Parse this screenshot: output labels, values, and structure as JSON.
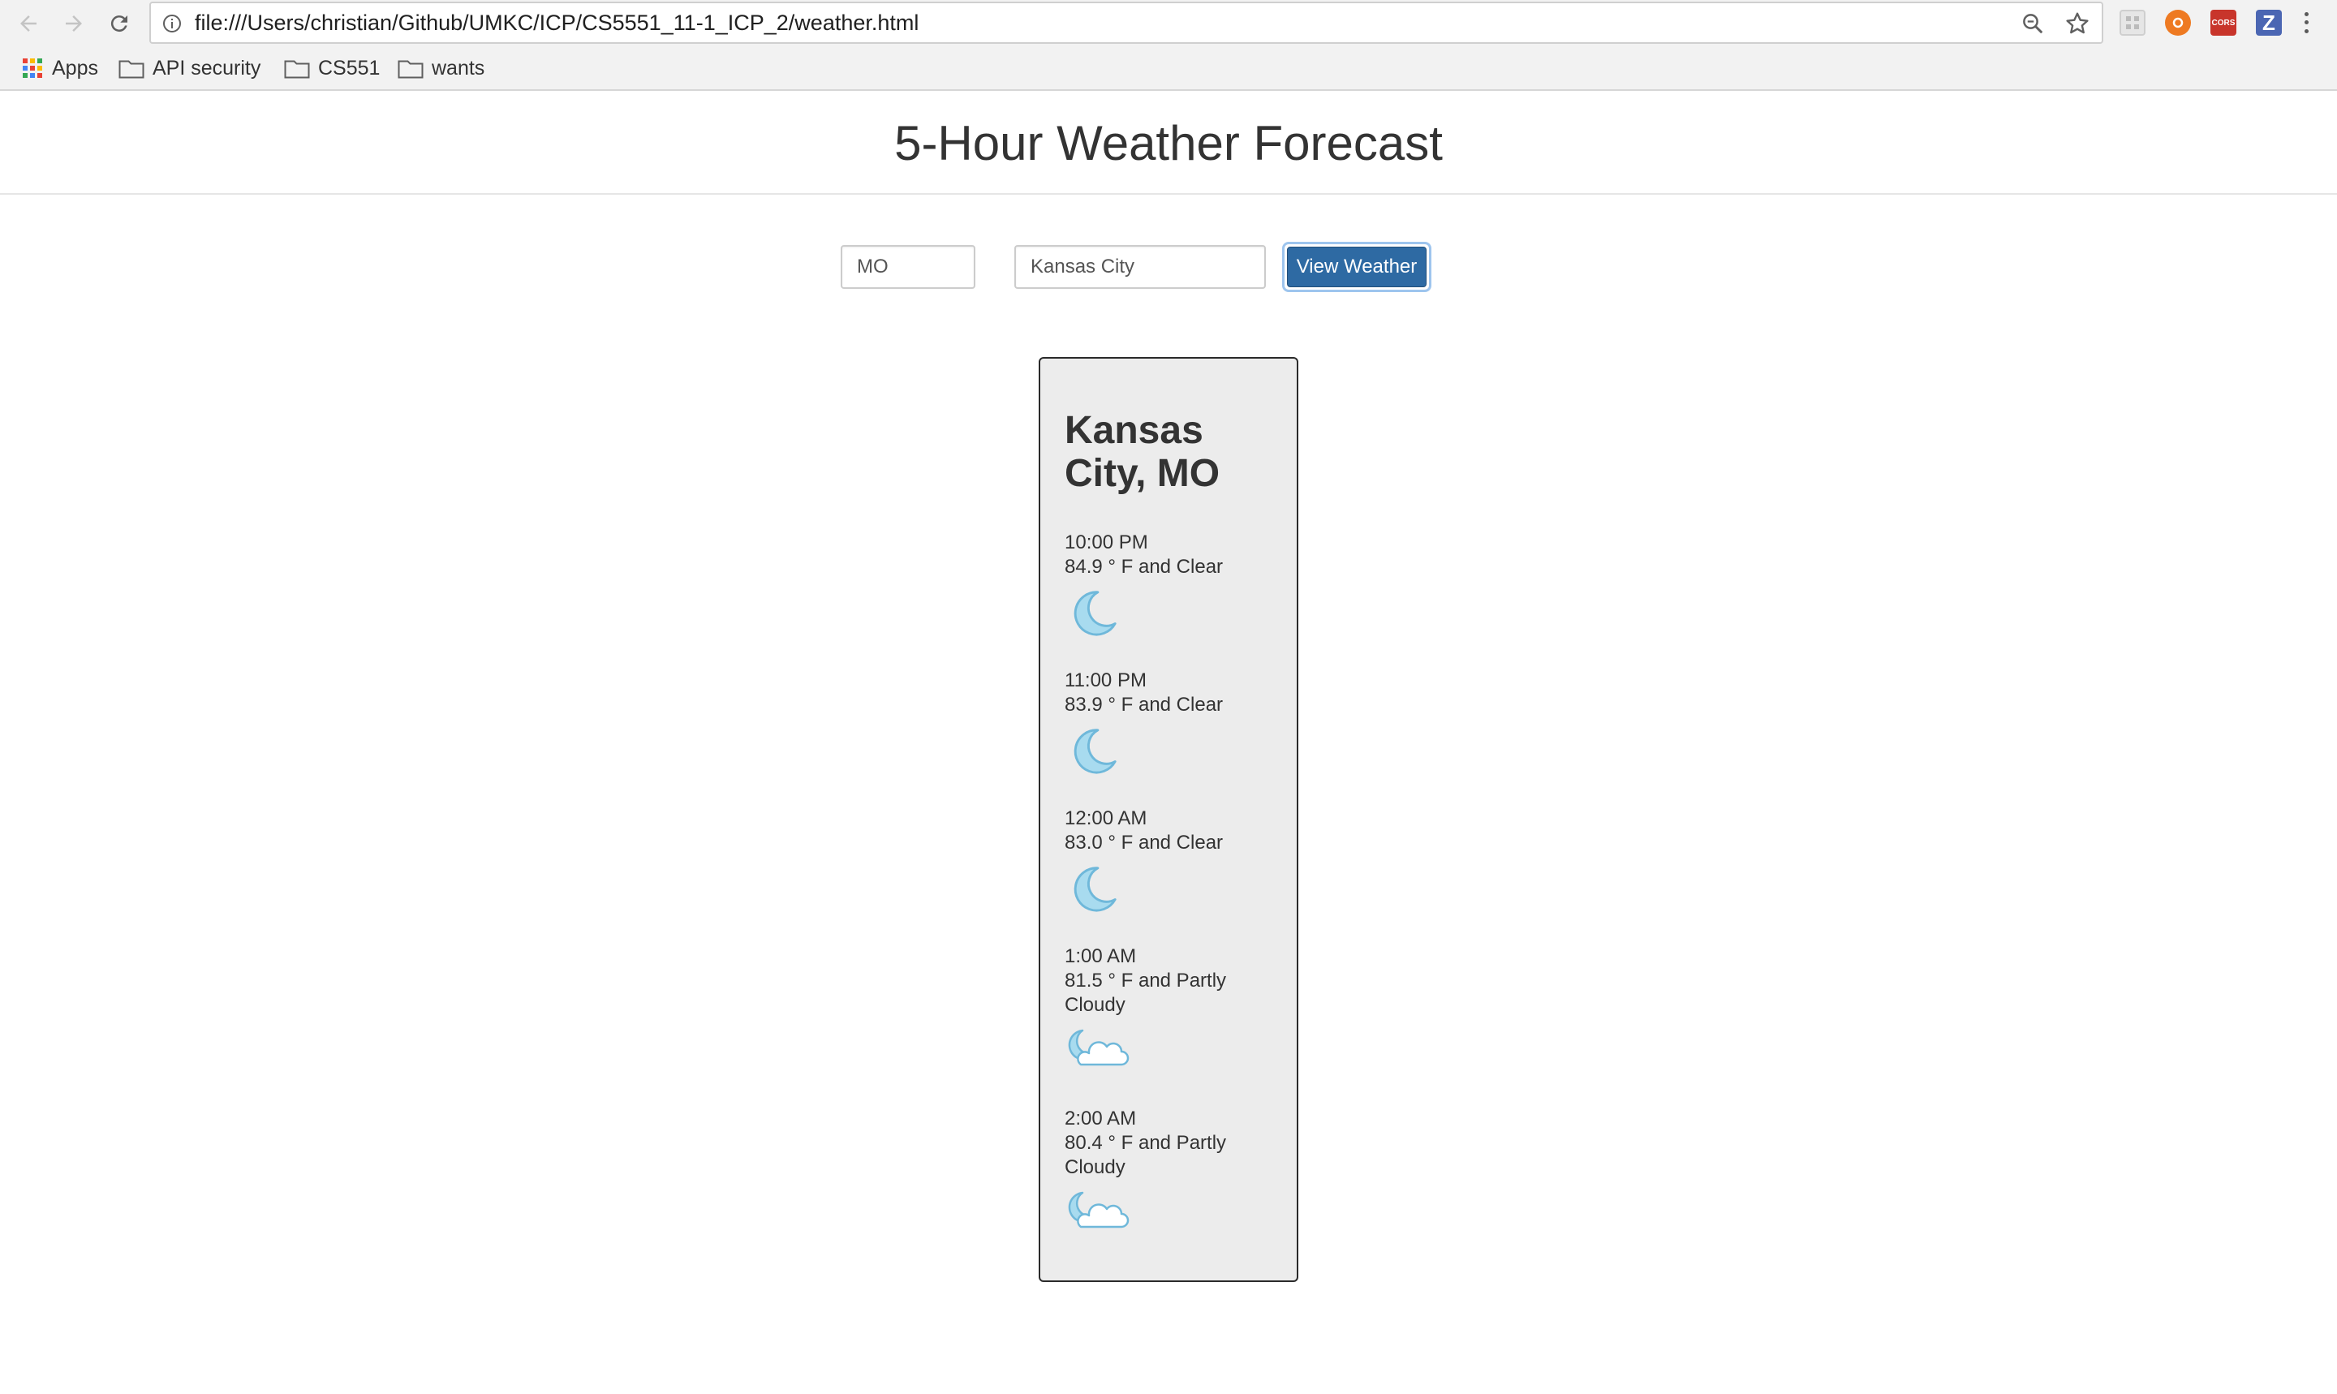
{
  "browser": {
    "url": "file:///Users/christian/Github/UMKC/ICP/CS5551_11-1_ICP_2/weather.html",
    "icons": {
      "back": "arrow-left-icon",
      "forward": "arrow-right-icon",
      "reload": "reload-icon",
      "info": "info-icon",
      "zoom": "magnifier-icon",
      "bookmark": "star-icon",
      "menu": "vertical-dots-icon"
    },
    "extensions": [
      {
        "name": "grid-extension-icon",
        "glyph": "",
        "color": "#d8d8d8"
      },
      {
        "name": "orange-extension-icon",
        "glyph": "",
        "color": "#ee7a22"
      },
      {
        "name": "cors-extension-icon",
        "glyph": "CORS",
        "color": "#c8352b"
      },
      {
        "name": "z-extension-icon",
        "glyph": "Z",
        "color": "#4b66b3"
      }
    ]
  },
  "bookmarks": [
    {
      "label": "Apps",
      "icon": "apps-grid-icon"
    },
    {
      "label": "API security",
      "icon": "folder-icon"
    },
    {
      "label": "CS551",
      "icon": "folder-icon"
    },
    {
      "label": "wants",
      "icon": "folder-icon"
    }
  ],
  "page": {
    "title": "5-Hour Weather Forecast"
  },
  "form": {
    "state_value": "MO",
    "city_value": "Kansas City",
    "submit_label": "View Weather",
    "submit_color": "#2e6aa3"
  },
  "forecast": {
    "location": "Kansas City, MO",
    "hours": [
      {
        "time": "10:00 PM",
        "desc": "84.9 ° F and Clear",
        "icon": "moon-icon"
      },
      {
        "time": "11:00 PM",
        "desc": "83.9 ° F and Clear",
        "icon": "moon-icon"
      },
      {
        "time": "12:00 AM",
        "desc": "83.0 ° F and Clear",
        "icon": "moon-icon"
      },
      {
        "time": "1:00 AM",
        "desc": "81.5 ° F and Partly Cloudy",
        "icon": "moon-cloud-icon"
      },
      {
        "time": "2:00 AM",
        "desc": "80.4 ° F and Partly Cloudy",
        "icon": "moon-cloud-icon"
      }
    ],
    "icon_color": "#8fcbe6"
  }
}
